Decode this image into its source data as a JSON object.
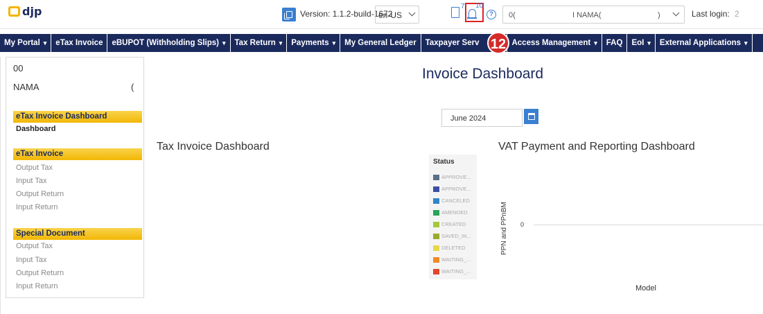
{
  "header": {
    "logo_text": "djp",
    "version": "Version: 1.1.2-build-1672",
    "language": "en-US",
    "documents_count": "7",
    "notifications_count": "10",
    "help_symbol": "?",
    "account_part1": "0(",
    "account_part2": "I NAMA(",
    "account_part3": ")",
    "last_login_label": "Last login:",
    "last_login_value": "2"
  },
  "nav": {
    "items": [
      {
        "label": "My Portal",
        "caret": "▾"
      },
      {
        "label": "eTax Invoice",
        "caret": ""
      },
      {
        "label": "eBUPOT (Withholding Slips)",
        "caret": "▾"
      },
      {
        "label": "Tax Return",
        "caret": "▾"
      },
      {
        "label": "Payments",
        "caret": "▾"
      },
      {
        "label": "My General Ledger",
        "caret": ""
      },
      {
        "label": "Taxpayer Serv",
        "caret": ""
      },
      {
        "label": "Access Management",
        "caret": "▾"
      },
      {
        "label": "FAQ",
        "caret": ""
      },
      {
        "label": "EoI",
        "caret": "▾"
      },
      {
        "label": "External Applications",
        "caret": "▾"
      }
    ],
    "step_badge": "12"
  },
  "sidebar": {
    "company_id": "00",
    "company_name": "NAMA",
    "company_tail": "(",
    "sections": [
      {
        "title": "eTax Invoice Dashboard",
        "items": [
          "Dashboard"
        ]
      },
      {
        "title": "eTax Invoice",
        "items": [
          "Output Tax",
          "Input Tax",
          "Output Return",
          "Input Return"
        ]
      },
      {
        "title": "Special Document",
        "items": [
          "Output Tax",
          "Input Tax",
          "Output Return",
          "Input Return"
        ]
      }
    ]
  },
  "main": {
    "title": "Invoice Dashboard",
    "period": "June 2024",
    "tax_invoice_title": "Tax Invoice Dashboard",
    "vat_title": "VAT Payment and Reporting Dashboard"
  },
  "legend": {
    "title": "Status",
    "entries": [
      {
        "label": "APPROVE...",
        "color": "#5b6f8a"
      },
      {
        "label": "APPROVE...",
        "color": "#3d4fa5"
      },
      {
        "label": "CANCELED",
        "color": "#2f86c9"
      },
      {
        "label": "AMENDED",
        "color": "#27a65a"
      },
      {
        "label": "CREATED",
        "color": "#a3c93a"
      },
      {
        "label": "SAVED_IN...",
        "color": "#9aab2e"
      },
      {
        "label": "DELETED",
        "color": "#e7d84a"
      },
      {
        "label": "WAITING_...",
        "color": "#f08a24"
      },
      {
        "label": "WAITING_...",
        "color": "#e2452a"
      }
    ]
  },
  "chart_data": {
    "type": "bar",
    "title": "VAT Payment and Reporting Dashboard",
    "xlabel": "Model",
    "ylabel": "PPN and PPnBM",
    "y_ticks": [
      "0"
    ],
    "categories": [],
    "series": []
  },
  "colors": {
    "nav_bg": "#1b2a5c",
    "accent_blue": "#3a7fd0",
    "section_yellow": "#f2b705",
    "badge_red": "#d42a2a"
  }
}
